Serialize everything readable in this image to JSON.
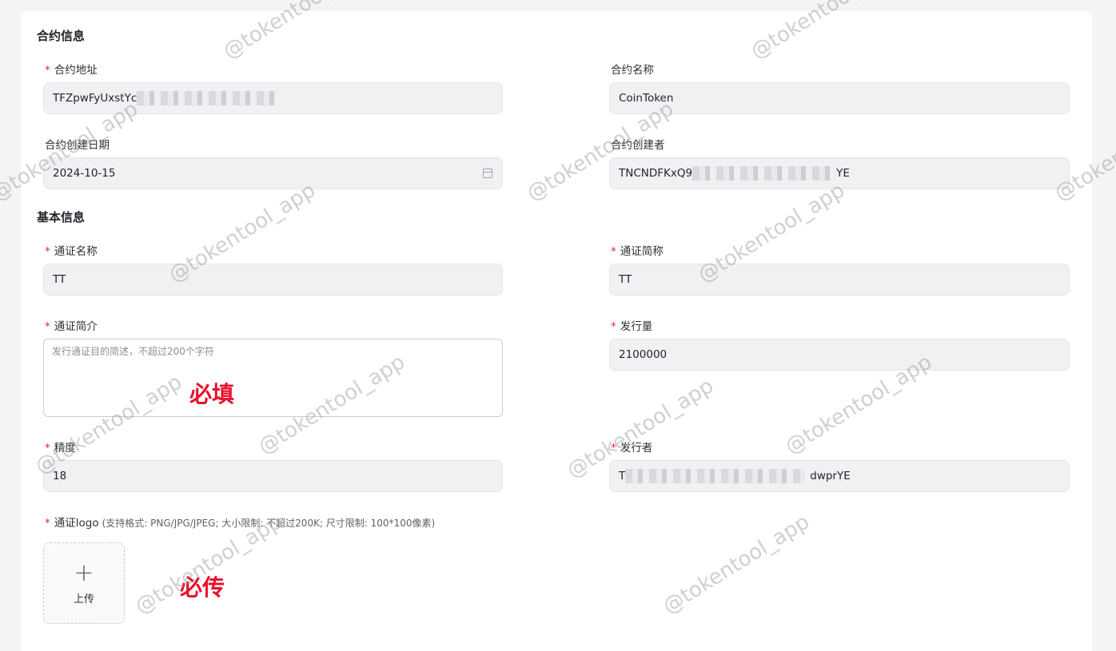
{
  "contract_section": {
    "title": "合约信息",
    "address": {
      "label": "合约地址",
      "value_prefix": "TFZpwFyUxstYc"
    },
    "name": {
      "label": "合约名称",
      "value": "CoinToken"
    },
    "created_date": {
      "label": "合约创建日期",
      "value": "2024-10-15",
      "icon": "calendar-icon"
    },
    "creator": {
      "label": "合约创建者",
      "value_prefix": "TNCNDFKxQ9",
      "value_suffix": "YE"
    }
  },
  "basic_section": {
    "title": "基本信息",
    "token_name": {
      "label": "通证名称",
      "value": "TT"
    },
    "token_symbol": {
      "label": "通证简称",
      "value": "TT"
    },
    "description": {
      "label": "通证简介",
      "placeholder": "发行通证目的简述，不超过200个字符"
    },
    "supply": {
      "label": "发行量",
      "value": "2100000"
    },
    "decimals": {
      "label": "精度",
      "value": "18"
    },
    "issuer": {
      "label": "发行者",
      "value_prefix": "T",
      "value_suffix": "dwprYE"
    },
    "logo": {
      "label": "通证logo",
      "hint": "(支持格式: PNG/JPG/JPEG; 大小限制: 不超过200K; 尺寸限制: 100*100像素)",
      "upload_label": "上传",
      "upload_icon": "plus-icon"
    }
  },
  "annotations": {
    "required_fill": "必填",
    "required_upload": "必传"
  },
  "watermark_text": "@tokentool_app",
  "required_mark": "*"
}
